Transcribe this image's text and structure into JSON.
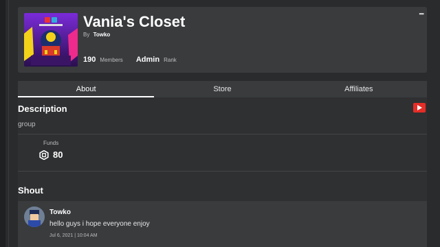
{
  "group": {
    "name": "Vania's Closet",
    "by_label": "By",
    "owner": "Towko",
    "members_count": "190",
    "members_label": "Members",
    "rank_value": "Admin",
    "rank_label": "Rank"
  },
  "tabs": [
    {
      "label": "About",
      "active": true
    },
    {
      "label": "Store",
      "active": false
    },
    {
      "label": "Affiliates",
      "active": false
    }
  ],
  "about": {
    "description_title": "Description",
    "description_text": "group",
    "funds_label": "Funds",
    "funds_value": "80",
    "shout_title": "Shout"
  },
  "shout": {
    "author": "Towko",
    "message": "hello guys i hope everyone enjoy",
    "timestamp": "Jul 6, 2021 | 10:04 AM"
  },
  "icons": {
    "menu": "more-dots-icon",
    "youtube": "youtube-icon",
    "currency": "robux-icon"
  },
  "colors": {
    "background": "#2a2b2d",
    "card": "#393b3d",
    "youtube_red": "#e52d27"
  }
}
